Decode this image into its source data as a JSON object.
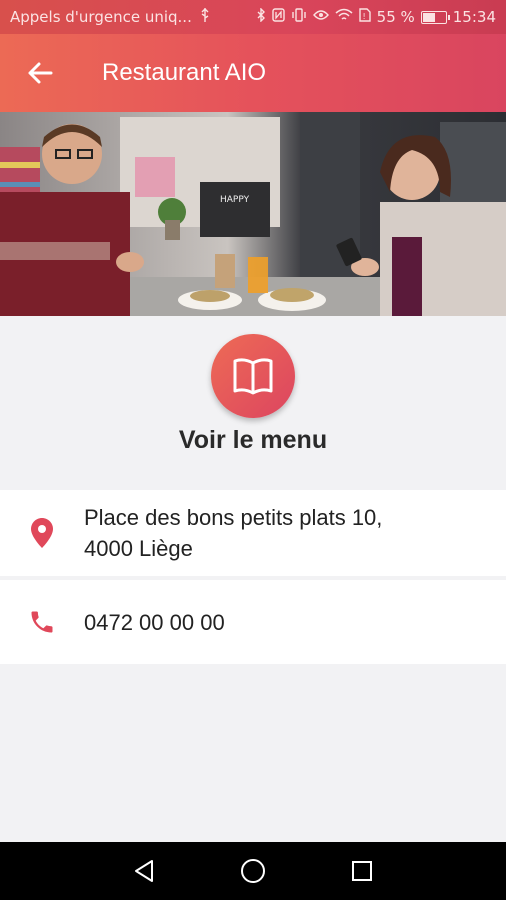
{
  "status_bar": {
    "carrier_text": "Appels d'urgence uniq...",
    "battery_percent": "55 %",
    "battery_level": 0.55,
    "time": "15:34",
    "icons": [
      "usb-icon",
      "bluetooth-icon",
      "nfc-icon",
      "vibrate-icon",
      "eye-comfort-icon",
      "wifi-icon",
      "sim-icon",
      "battery-icon"
    ]
  },
  "app_bar": {
    "title": "Restaurant AIO",
    "back_icon": "arrow-left-icon",
    "background_colors": [
      "#ec6a55",
      "#d9455f"
    ]
  },
  "hero": {
    "description_icon": "restaurant-photo"
  },
  "menu": {
    "label": "Voir le menu",
    "icon": "book-open-icon",
    "accent_color": "#e5525b"
  },
  "contact": {
    "address_line1": "Place des bons petits plats 10,",
    "address_line2": "4000 Liège",
    "address_icon": "location-pin-icon",
    "phone": "0472 00 00 00",
    "phone_icon": "phone-icon",
    "icon_color": "#e0485a"
  },
  "nav_bar": {
    "back": "nav-back-icon",
    "home": "nav-home-icon",
    "recents": "nav-recents-icon"
  }
}
